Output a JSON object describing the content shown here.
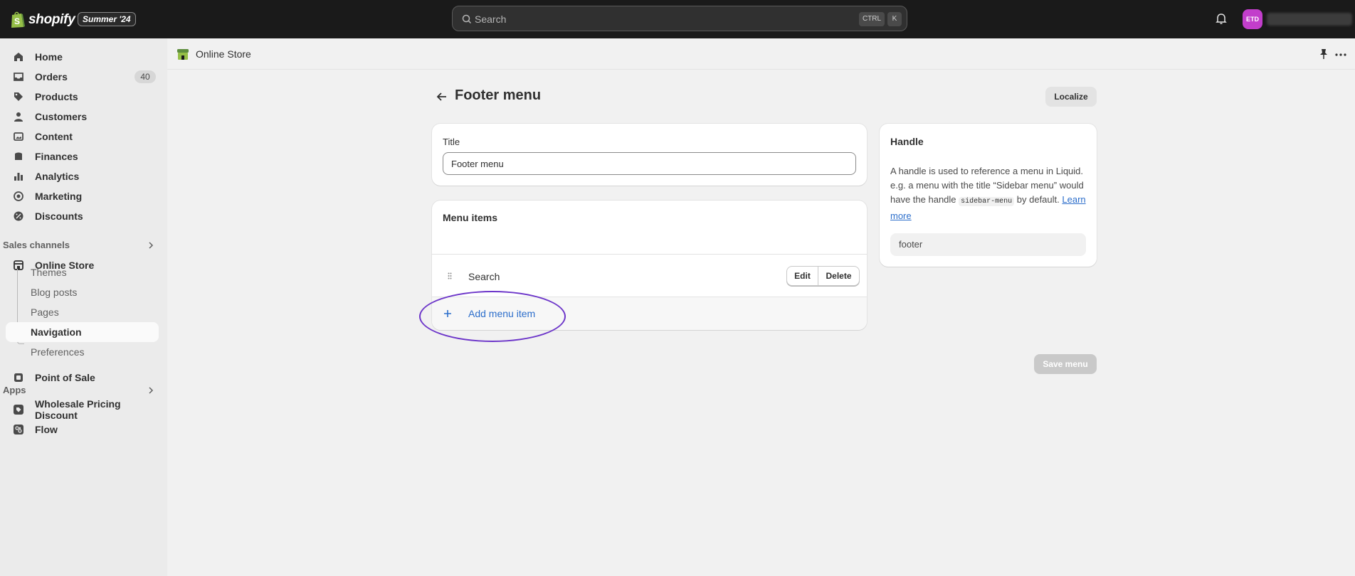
{
  "topbar": {
    "brand": "shopify",
    "edition": "Summer '24",
    "search_placeholder": "Search",
    "shortcut_ctrl": "CTRL",
    "shortcut_k": "K",
    "avatar_initials": "ETD",
    "avatar_color": "#c23ecb"
  },
  "sidebar": {
    "items": [
      {
        "label": "Home",
        "icon": "home-icon"
      },
      {
        "label": "Orders",
        "icon": "inbox-icon",
        "badge": "40"
      },
      {
        "label": "Products",
        "icon": "tag-icon"
      },
      {
        "label": "Customers",
        "icon": "person-icon"
      },
      {
        "label": "Content",
        "icon": "image-icon"
      },
      {
        "label": "Finances",
        "icon": "bank-icon"
      },
      {
        "label": "Analytics",
        "icon": "bar-chart-icon"
      },
      {
        "label": "Marketing",
        "icon": "target-icon"
      },
      {
        "label": "Discounts",
        "icon": "discount-icon"
      }
    ],
    "sales_channels_heading": "Sales channels",
    "online_store": "Online Store",
    "online_store_subitems": [
      "Themes",
      "Blog posts",
      "Pages",
      "Navigation",
      "Preferences"
    ],
    "point_of_sale": "Point of Sale",
    "apps_heading": "Apps",
    "apps": [
      "Wholesale Pricing Discount",
      "Flow"
    ]
  },
  "page_header": {
    "channel": "Online Store"
  },
  "main": {
    "title": "Footer menu",
    "localize_label": "Localize",
    "title_field": {
      "label": "Title",
      "value": "Footer menu"
    },
    "menu_items": {
      "heading": "Menu items",
      "rows": [
        {
          "label": "Search",
          "edit": "Edit",
          "delete": "Delete"
        }
      ],
      "add_label": "Add menu item"
    },
    "handle": {
      "heading": "Handle",
      "desc_1": "A handle is used to reference a menu in Liquid. e.g. a menu with the title “Sidebar menu” would have the handle ",
      "desc_code": "sidebar-menu",
      "desc_2": " by default. ",
      "learn_more": "Learn more",
      "value": "footer"
    },
    "save_label": "Save menu"
  },
  "colors": {
    "topbar_bg": "#1a1a1a",
    "link": "#2c6ecb",
    "annotation": "#6c35c9"
  }
}
